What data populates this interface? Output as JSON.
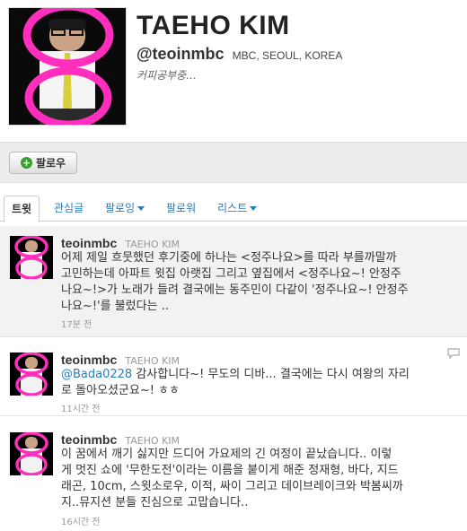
{
  "profile": {
    "name": "TAEHO KIM",
    "handle": "@teoinmbc",
    "location": "MBC, SEOUL, KOREA",
    "bio": "커피공부중..."
  },
  "follow_button": {
    "label": "팔로우",
    "icon": "plus-icon"
  },
  "tabs": [
    {
      "label": "트윗",
      "active": true
    },
    {
      "label": "관심글"
    },
    {
      "label": "팔로잉",
      "dropdown": true
    },
    {
      "label": "팔로워"
    },
    {
      "label": "리스트",
      "dropdown": true
    }
  ],
  "tweets": [
    {
      "username": "teoinmbc",
      "realname": "TAEHO KIM",
      "lines": [
        "어제 제일 흐뭇했던 후기중에 하나는 <정주나요>를 따라 부를까말까",
        "고민하는데 아파트 윗집 아랫집 그리고 옆집에서 <정주나요~! 안정주",
        "나요~!>가 노래가 들려 결국에는 동주민이 다같이 '정주나요~! 안정주",
        "나요~!'를 불렀다는 .."
      ],
      "time": "17분 전"
    },
    {
      "username": "teoinmbc",
      "realname": "TAEHO KIM",
      "mention": "@Bada0228",
      "line1_rest": " 감사합니다~! 무도의 디바... 결국에는 다시 여왕의 자리",
      "line2": "로 돌아오셨군요~! ㅎㅎ",
      "time": "11시간 전"
    },
    {
      "username": "teoinmbc",
      "realname": "TAEHO KIM",
      "lines": [
        "이 꿈에서 깨기 싫지만 드디어 가요제의 긴 여정이 끝났습니다.. 이렇",
        "게 멋진 쇼에 '무한도전'이라는 이름을 붙이게 해준 정재형, 바다, 지드",
        "래곤, 10cm, 스윗소로우, 이적, 싸이 그리고 데이브레이크와 박봄씨까",
        "지..뮤지션 분들 진심으로 고맙습니다.."
      ],
      "time": "16시간 전"
    }
  ],
  "colors": {
    "accent_pink": "#ff2ebd",
    "link_blue": "#2b7bb9",
    "follow_plus": "#3a9d2f"
  }
}
